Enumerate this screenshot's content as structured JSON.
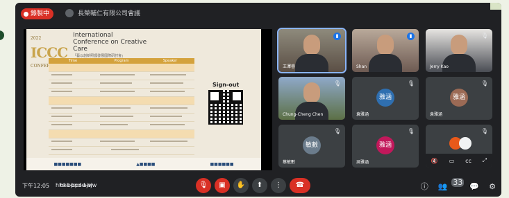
{
  "recording": {
    "label": "錄製中"
  },
  "meeting": {
    "title": "長榮輔仁有限公司會議"
  },
  "slide": {
    "year": "2022",
    "logo": "ICCC",
    "logo_sub": "CONFERENCE",
    "conference_title": "International Conference on Creative Care",
    "conference_subtitle": "「藝以創新照護發展國際研討會」",
    "columns": [
      "Time",
      "Program",
      "Speaker"
    ],
    "signout": "Sign-out"
  },
  "participants": [
    {
      "name": "王澤睿",
      "type": "video",
      "mic": "speaking",
      "active": true
    },
    {
      "name": "Shan",
      "type": "video",
      "mic": "speaking"
    },
    {
      "name": "Jerry Kao",
      "type": "video",
      "mic": "muted"
    },
    {
      "name": "Chung-Cheng Chen",
      "type": "video",
      "mic": "muted"
    },
    {
      "name": "袁雅涵",
      "type": "avatar",
      "initials": "雅涵",
      "color": "#2f6fb0",
      "mic": "muted"
    },
    {
      "name": "袁雅涵",
      "type": "avatar",
      "initials": "雅涵",
      "color": "#9b6a55",
      "mic": "muted"
    },
    {
      "name": "蔡敏數",
      "type": "avatar",
      "initials": "敏數",
      "color": "#6b7c8c",
      "mic": "muted"
    },
    {
      "name": "吳雅涵",
      "type": "avatar",
      "initials": "雅涵",
      "color": "#c2185b",
      "mic": "muted"
    },
    {
      "name": "",
      "type": "controls",
      "mic": "muted"
    }
  ],
  "bottombar": {
    "clock": "下午12:05",
    "meeting_code": "hks-bpxd-ajw",
    "participant_count": "33"
  }
}
